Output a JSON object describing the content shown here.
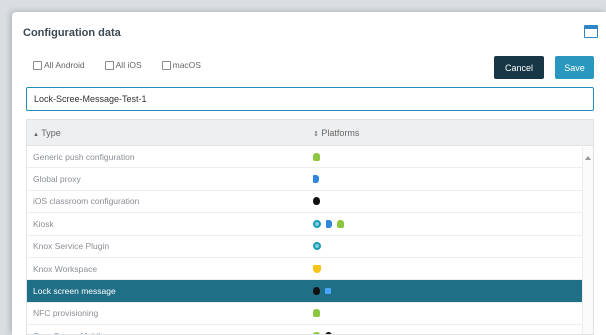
{
  "dialog": {
    "title": "Configuration data"
  },
  "filters": [
    {
      "label": "All Android"
    },
    {
      "label": "All iOS"
    },
    {
      "label": "macOS"
    }
  ],
  "buttons": {
    "cancel": "Cancel",
    "save": "Save"
  },
  "name_field": {
    "value": "Lock-Scree-Message-Test-1"
  },
  "table": {
    "columns": {
      "type": "Type",
      "type_sort": "▲",
      "platforms": "Platforms",
      "platforms_sort": "⇕"
    },
    "rows": [
      {
        "type": "Generic push configuration",
        "platforms": [
          "android-icon"
        ]
      },
      {
        "type": "Global proxy",
        "platforms": [
          "ios-icon"
        ]
      },
      {
        "type": "iOS classroom configuration",
        "platforms": [
          "apple-icon"
        ]
      },
      {
        "type": "Kiosk",
        "platforms": [
          "globe-icon",
          "ios-icon",
          "android-icon"
        ]
      },
      {
        "type": "Knox Service Plugin",
        "platforms": [
          "globe-icon"
        ]
      },
      {
        "type": "Knox Workspace",
        "platforms": [
          "shield-icon"
        ]
      },
      {
        "type": "Lock screen message",
        "platforms": [
          "apple-icon",
          "badge-icon"
        ],
        "selected": true
      },
      {
        "type": "NFC provisioning",
        "platforms": [
          "android-icon"
        ]
      },
      {
        "type": "OpenScape Mobile",
        "platforms": [
          "android-icon",
          "apple-icon"
        ]
      }
    ]
  },
  "colors": {
    "accent": "#2a97bf",
    "cancel": "#173746",
    "selected_row": "#1f6f86"
  }
}
